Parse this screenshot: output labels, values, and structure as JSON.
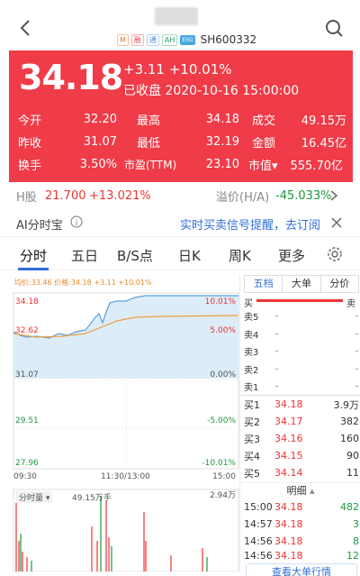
{
  "nav": {
    "back": "back",
    "search": "search",
    "code": "SH600332",
    "tags": [
      "M",
      "融",
      "通",
      "AH",
      "ESG"
    ]
  },
  "quote": {
    "price": "34.18",
    "change": "+3.11 +10.01%",
    "status": "已收盘 2020-10-16 15:00:00",
    "stats": [
      [
        "今开",
        "32.20",
        "最高",
        "34.18",
        "成交",
        "49.15万"
      ],
      [
        "昨收",
        "31.07",
        "最低",
        "32.19",
        "金额",
        "16.45亿"
      ],
      [
        "换手",
        "3.50%",
        "市盈(TTM)",
        "23.10",
        "市值▾",
        "555.70亿"
      ]
    ]
  },
  "hk": {
    "label": "H股",
    "price": "21.700",
    "change": "+13.021%",
    "premium_label": "溢价(H/A)",
    "premium": "-45.033%"
  },
  "ai": {
    "label": "AI分时宝",
    "promo": "实时买卖信号提醒，去订阅"
  },
  "tabs": [
    "分时",
    "五日",
    "B/S点",
    "日K",
    "周K",
    "更多"
  ],
  "chart": {
    "legend": "均价:33.46 价格:34.18 +3.11 +10.01%",
    "left_ticks": [
      "34.18",
      "32.62",
      "31.07",
      "29.51",
      "27.96"
    ],
    "right_ticks": [
      "10.01%",
      "5.00%",
      "0.00%",
      "-5.00%",
      "-10.01%"
    ],
    "time_labels": [
      "09:30",
      "11:30/13:00",
      "15:00"
    ],
    "volume_label": "分时量",
    "volume_total": "49.15万手",
    "volume_max": "2.94万"
  },
  "side": {
    "tabs": [
      "五档",
      "大单",
      "分价"
    ],
    "buy": "买",
    "sell": "卖",
    "sells": [
      [
        "卖5",
        "–",
        "–"
      ],
      [
        "卖4",
        "–",
        "–"
      ],
      [
        "卖3",
        "–",
        "–"
      ],
      [
        "卖2",
        "–",
        "–"
      ],
      [
        "卖1",
        "–",
        "–"
      ]
    ],
    "buys": [
      [
        "买1",
        "34.18",
        "3.9万"
      ],
      [
        "买2",
        "34.17",
        "382"
      ],
      [
        "买3",
        "34.16",
        "160"
      ],
      [
        "买4",
        "34.15",
        "90"
      ],
      [
        "买5",
        "34.14",
        "11"
      ]
    ],
    "detail": "明细",
    "trades": [
      [
        "15:00",
        "34.18",
        "482"
      ],
      [
        "14:57",
        "34.18",
        "3"
      ],
      [
        "14:56",
        "34.18",
        "8"
      ],
      [
        "14:56",
        "34.18",
        "12"
      ]
    ],
    "more": "查看大单行情"
  }
}
